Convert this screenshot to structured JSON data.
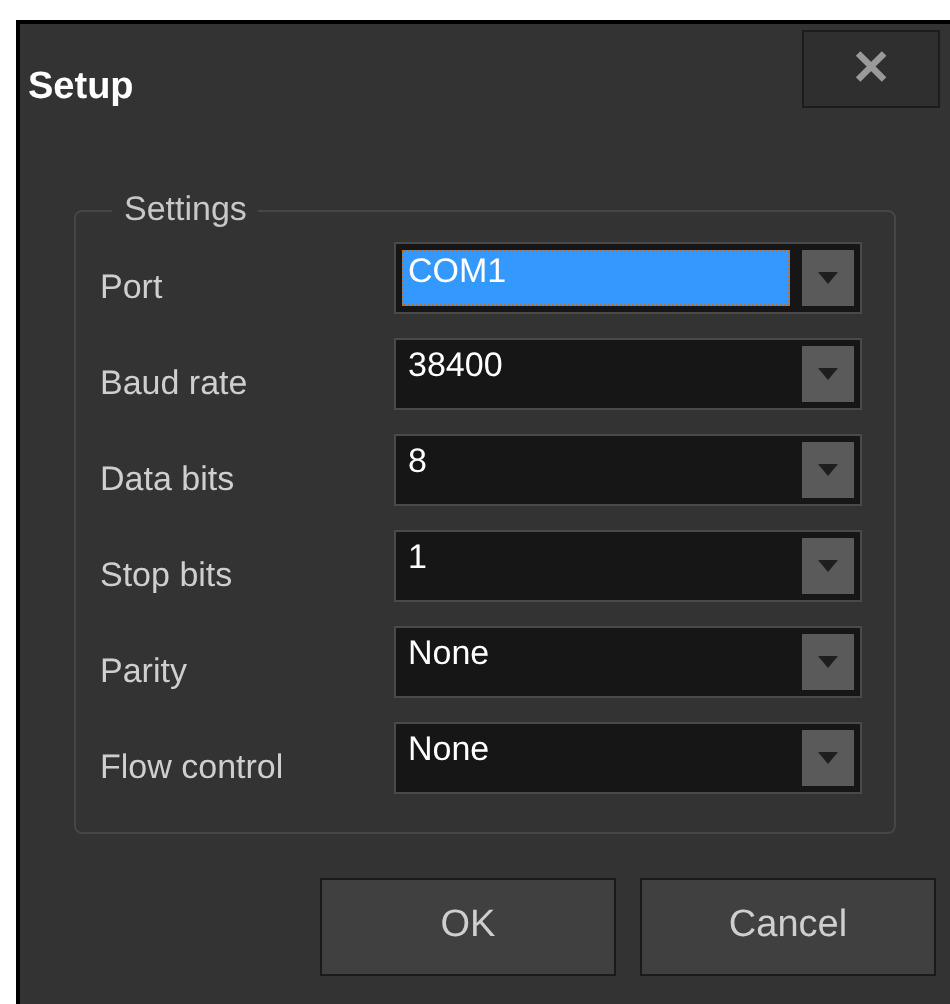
{
  "window": {
    "title": "Setup",
    "close": "✕"
  },
  "group": {
    "legend": "Settings",
    "fields": [
      {
        "label": "Port",
        "value": "COM1",
        "selected": true
      },
      {
        "label": "Baud rate",
        "value": "38400",
        "selected": false
      },
      {
        "label": "Data bits",
        "value": "8",
        "selected": false
      },
      {
        "label": "Stop bits",
        "value": "1",
        "selected": false
      },
      {
        "label": "Parity",
        "value": "None",
        "selected": false
      },
      {
        "label": "Flow control",
        "value": "None",
        "selected": false
      }
    ]
  },
  "buttons": [
    "OK",
    "Cancel"
  ]
}
